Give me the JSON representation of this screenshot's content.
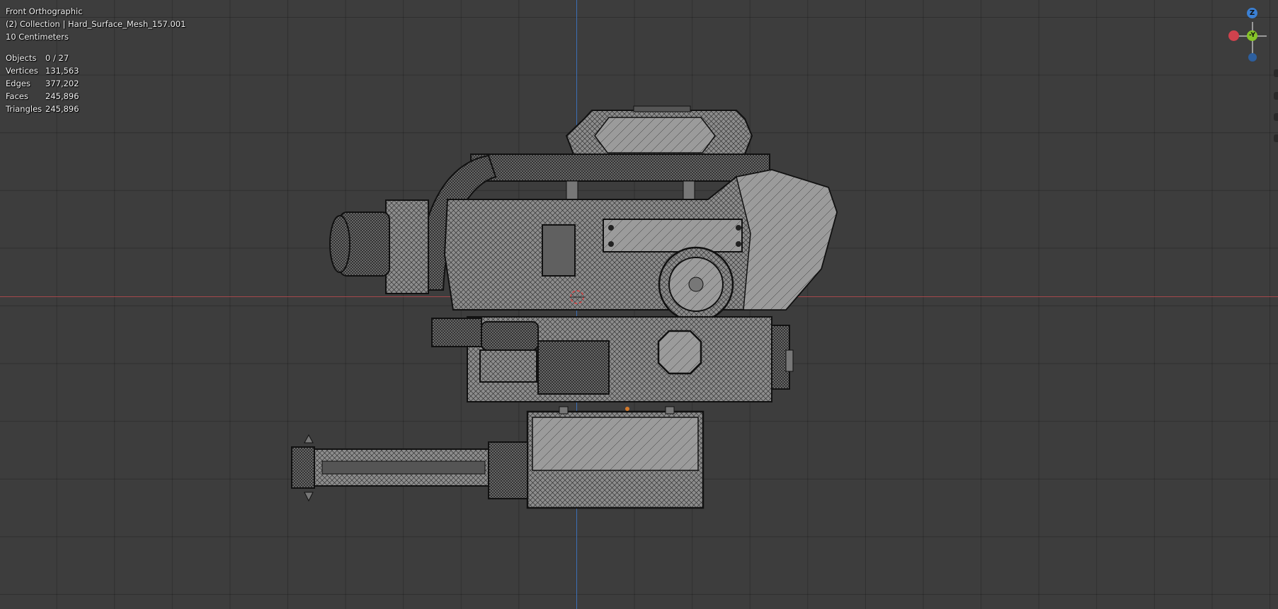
{
  "viewport": {
    "view_name": "Front Orthographic",
    "collection_label": "(2) Collection | Hard_Surface_Mesh_157.001",
    "grid_scale": "10 Centimeters"
  },
  "stats": [
    {
      "label": "Objects",
      "value": "0 / 27"
    },
    {
      "label": "Vertices",
      "value": "131,563"
    },
    {
      "label": "Edges",
      "value": "377,202"
    },
    {
      "label": "Faces",
      "value": "245,896"
    },
    {
      "label": "Triangles",
      "value": "245,896"
    }
  ],
  "gizmo": {
    "z_label": "Z",
    "y_label": "-Y",
    "colors": {
      "x": "#d0424d",
      "y": "#86c428",
      "z": "#3b80d4"
    }
  },
  "colors": {
    "background": "#3d3d3d",
    "x_axis": "#a5484b",
    "z_axis": "#3c6fb5",
    "mesh_fill": "#8a8a8a",
    "wire": "#1a1a1a"
  }
}
